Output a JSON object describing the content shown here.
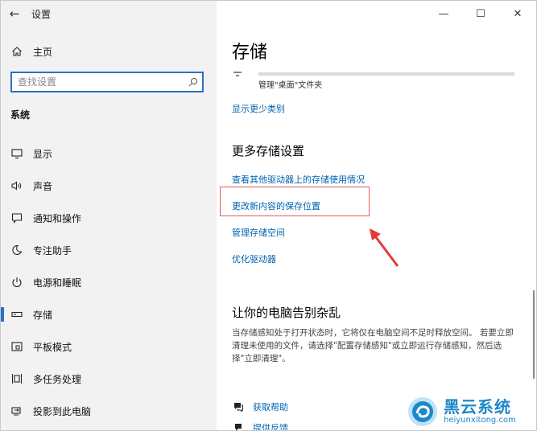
{
  "window": {
    "title": "设置",
    "back_glyph": "←",
    "minimize_glyph": "—",
    "maximize_glyph": "☐",
    "close_glyph": "✕"
  },
  "sidebar": {
    "home_label": "主页",
    "search_placeholder": "查找设置",
    "section_heading": "系统",
    "items": [
      {
        "label": "显示",
        "icon": "monitor-icon"
      },
      {
        "label": "声音",
        "icon": "speaker-icon"
      },
      {
        "label": "通知和操作",
        "icon": "notification-icon"
      },
      {
        "label": "专注助手",
        "icon": "moon-icon"
      },
      {
        "label": "电源和睡眠",
        "icon": "power-icon"
      },
      {
        "label": "存储",
        "icon": "storage-icon",
        "active": true
      },
      {
        "label": "平板模式",
        "icon": "tablet-icon"
      },
      {
        "label": "多任务处理",
        "icon": "multitask-icon"
      },
      {
        "label": "投影到此电脑",
        "icon": "project-icon"
      }
    ]
  },
  "main": {
    "title": "存储",
    "folder_label": "管理\"桌面\"文件夹",
    "show_fewer_link": "显示更少类别",
    "more_storage_heading": "更多存储设置",
    "links": [
      "查看其他驱动器上的存储使用情况",
      "更改新内容的保存位置",
      "管理存储空间",
      "优化驱动器"
    ],
    "declutter_heading": "让你的电脑告别杂乱",
    "declutter_text": "当存储感知处于打开状态时，它将仅在电脑空间不足时释放空间。 若要立即清理未使用的文件，请选择\"配置存储感知\"或立即运行存储感知，然后选择\"立即清理\"。",
    "help_link": "获取帮助",
    "feedback_link": "提供反馈"
  },
  "watermark": {
    "name": "黑云系统",
    "url": "heiyunxitong.com"
  },
  "colors": {
    "accent": "#2a70c7",
    "link": "#0063b1",
    "highlight": "#e25b5b",
    "sidebar_bg": "#f2f2f2"
  }
}
